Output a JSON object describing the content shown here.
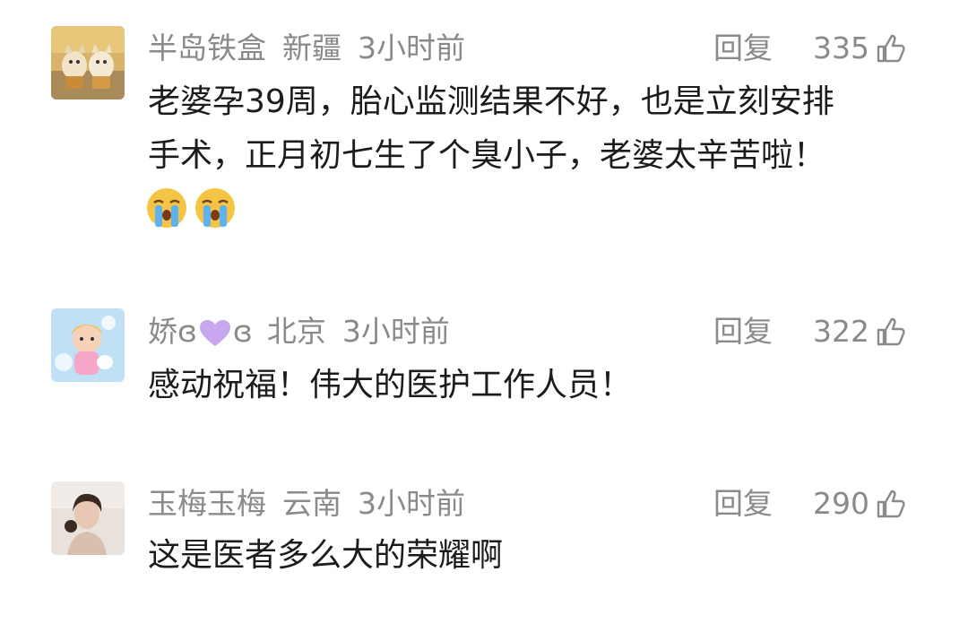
{
  "comments": [
    {
      "username": "半岛铁盒",
      "location": "新疆",
      "time": "3小时前",
      "reply_label": "回复",
      "likes": "335",
      "text_lines": [
        "老婆孕39周，胎心监测结果不好，也是立刻安排",
        "手术，正月初七生了个臭小子，老婆太辛苦啦！"
      ],
      "emojis": [
        "crying-face-icon",
        "crying-face-icon"
      ]
    },
    {
      "username_prefix": "娇ɞ",
      "username_suffix": "ɞ",
      "location": "北京",
      "time": "3小时前",
      "reply_label": "回复",
      "likes": "322",
      "text_lines": [
        "感动祝福！伟大的医护工作人员！"
      ]
    },
    {
      "username": "玉梅玉梅",
      "location": "云南",
      "time": "3小时前",
      "reply_label": "回复",
      "likes": "290",
      "text_lines": [
        "这是医者多么大的荣耀啊"
      ]
    }
  ],
  "colors": {
    "meta_text": "#8a8a8a",
    "body_text": "#1c1c1c",
    "heart": "#c9a7ee"
  }
}
